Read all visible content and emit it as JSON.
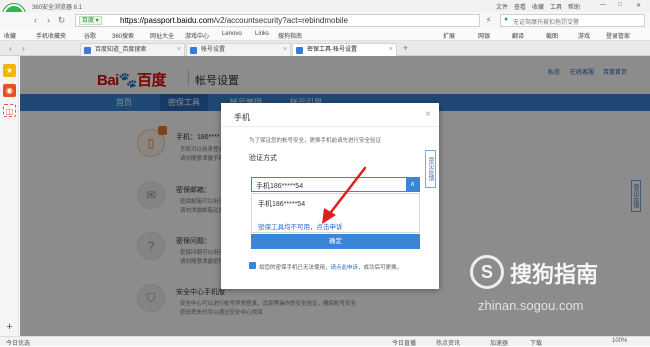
{
  "window": {
    "title": "360安全浏览器 8.1",
    "menu": [
      "文件",
      "查看",
      "收藏",
      "工具",
      "帮助"
    ]
  },
  "navbar": {
    "mode_badge": "百度 ▾",
    "url_host": "https://passport.baidu.com",
    "url_path": "/v2/accountsecurity?act=rebindmobile",
    "search_placeholder": "无证驾摩托被扣拖罚交警"
  },
  "bookmarks": [
    "收藏",
    "手机收藏夹",
    "谷歌",
    "360搜索",
    "网址大全",
    "游戏中心",
    "Lenovo",
    "Links",
    "搜狗指南"
  ],
  "bookmarks_right": [
    "扩展",
    "网银",
    "翻译",
    "截图",
    "游戏",
    "登录管家"
  ],
  "tabs": [
    "百度知道_百度搜索",
    "帐号设置",
    "密保工具-帐号设置"
  ],
  "page": {
    "logo_bai": "Bai",
    "logo_du": "百度",
    "title": "帐号设置",
    "top_links": [
      "私信",
      "在线客服",
      "百度首页"
    ],
    "nav": [
      "首页",
      "密保工具",
      "帐号管理",
      "帐号引用"
    ],
    "nav_selected_index": 1,
    "rows": [
      {
        "title": "手机：186****",
        "lines": [
          "手机可以用来登录百度帐号、找回密码",
          "请勿随意泄露手机号"
        ]
      },
      {
        "title": "密保邮箱：",
        "lines": [
          "密保邮箱可以用来找回密码",
          "请勿泄露邮箱及密码"
        ]
      },
      {
        "title": "密保问题：",
        "lines": [
          "密保问题可以用来找回密码",
          "请勿随意泄露密保问题"
        ]
      },
      {
        "title": "安全中心手机版",
        "lines": [
          "安全中心可以进行帐号异常登录、消息等操作的安全验证，确保帐号安全",
          "密码丢失时可以通过安全中心找回"
        ]
      }
    ],
    "side_feedback": "意见反馈"
  },
  "modal": {
    "title": "手机",
    "close": "×",
    "note": "为了保证您的帐号安全，更换手机前请先进行安全验证",
    "label": "验证方式",
    "selected": "手机186*****54",
    "option": "手机186*****54",
    "option_link": "密保工具均不可用，点击申诉",
    "confirm": "确定",
    "footer_text": "如您的密保手机已无法使用，",
    "footer_link": "请点此申诉",
    "footer_tail": "，成功后可更换。",
    "feedback": "意见反馈"
  },
  "watermark": {
    "mark": "S",
    "text": "搜狗指南",
    "sub": "zhinan.sogou.com"
  },
  "statusbar": {
    "left": "今日优选",
    "items": [
      "今日直播",
      "热点资讯",
      "加速器",
      "下载",
      "100%"
    ]
  }
}
